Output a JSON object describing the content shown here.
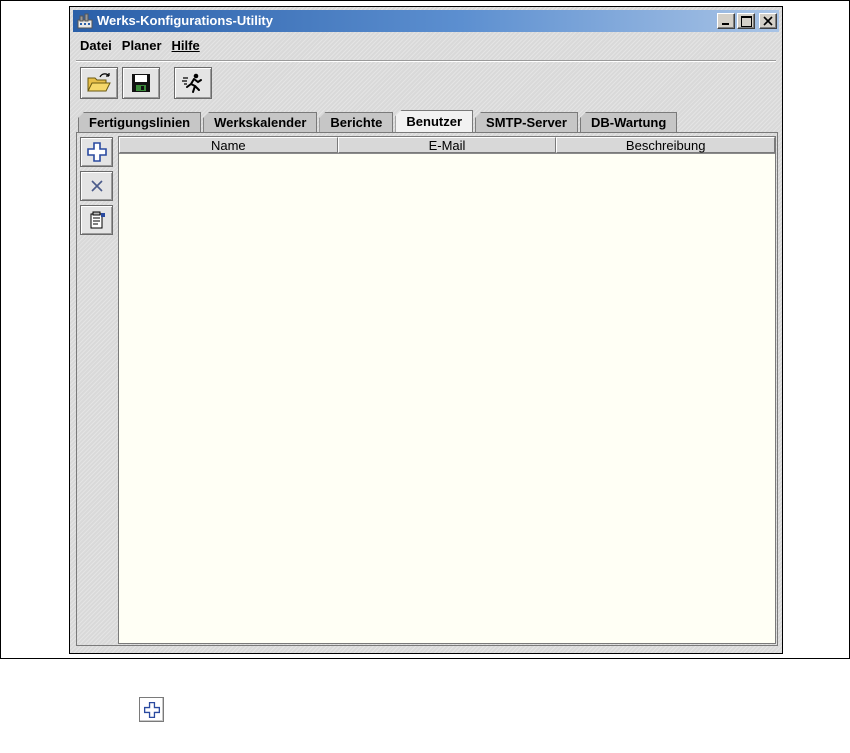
{
  "window": {
    "title": "Werks-Konfigurations-Utility",
    "controls": {
      "minimize": "minimize",
      "maximize": "maximize",
      "close": "close"
    }
  },
  "menu": {
    "items": [
      {
        "label": "Datei",
        "underline": false
      },
      {
        "label": "Planer",
        "underline": false
      },
      {
        "label": "Hilfe",
        "underline": true
      }
    ]
  },
  "toolbar": {
    "buttons": [
      {
        "icon": "open-folder-icon"
      },
      {
        "icon": "save-icon"
      },
      {
        "icon": "run-icon"
      }
    ]
  },
  "tabs": [
    {
      "label": "Fertigungslinien",
      "active": false
    },
    {
      "label": "Werkskalender",
      "active": false
    },
    {
      "label": "Berichte",
      "active": false
    },
    {
      "label": "Benutzer",
      "active": true
    },
    {
      "label": "SMTP-Server",
      "active": false
    },
    {
      "label": "DB-Wartung",
      "active": false
    }
  ],
  "side_tools": [
    {
      "icon": "add-icon"
    },
    {
      "icon": "delete-icon"
    },
    {
      "icon": "properties-icon"
    }
  ],
  "table": {
    "columns": [
      "Name",
      "E-Mail",
      "Beschreibung"
    ],
    "rows": []
  },
  "bottom_icon": "add-icon",
  "colors": {
    "title_bar": "#2a5fa8",
    "table_background": "#fffff5",
    "add_icon": "#2a4aa0"
  }
}
